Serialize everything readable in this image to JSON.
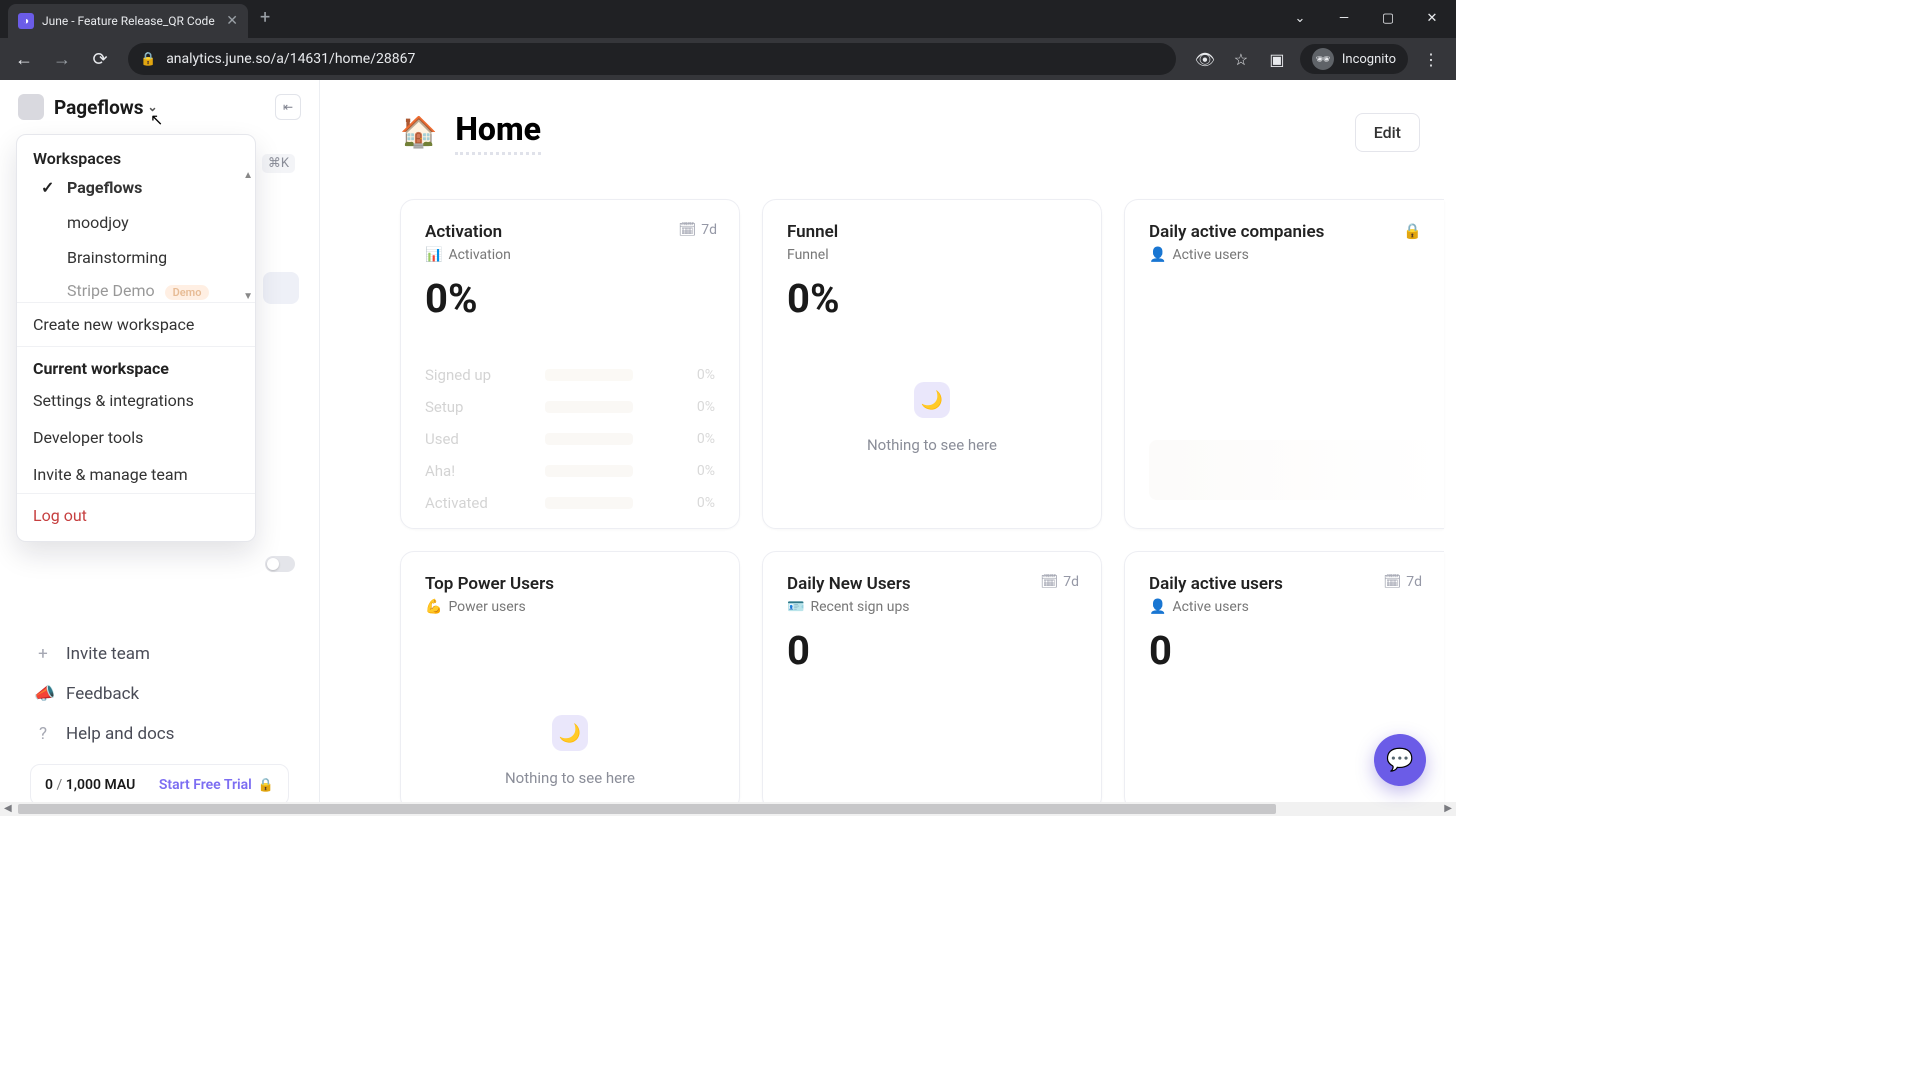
{
  "browser": {
    "tab_title": "June - Feature Release_QR Code",
    "url": "analytics.june.so/a/14631/home/28867",
    "incognito_label": "Incognito"
  },
  "sidebar": {
    "workspace_name": "Pageflows",
    "shortcut": "⌘K",
    "dropdown": {
      "section1_title": "Workspaces",
      "items": [
        {
          "name": "Pageflows",
          "selected": true
        },
        {
          "name": "moodjoy",
          "selected": false
        },
        {
          "name": "Brainstorming",
          "selected": false
        },
        {
          "name": "Stripe Demo",
          "selected": false,
          "badge": "Demo"
        }
      ],
      "create": "Create new workspace",
      "section2_title": "Current workspace",
      "links": {
        "settings": "Settings & integrations",
        "devtools": "Developer tools",
        "invite": "Invite & manage team"
      },
      "logout": "Log out"
    },
    "bottom": {
      "invite_team": "Invite team",
      "feedback": "Feedback",
      "help": "Help and docs"
    },
    "mau": {
      "current": "0",
      "limit": "1,000",
      "unit": "MAU",
      "trial": "Start Free Trial"
    }
  },
  "page": {
    "title": "Home",
    "edit": "Edit"
  },
  "cards": {
    "activation": {
      "title": "Activation",
      "subtitle": "Activation",
      "period": "7d",
      "value": "0%",
      "rows": [
        {
          "label": "Signed up",
          "pct": "0%"
        },
        {
          "label": "Setup",
          "pct": "0%"
        },
        {
          "label": "Used",
          "pct": "0%"
        },
        {
          "label": "Aha!",
          "pct": "0%"
        },
        {
          "label": "Activated",
          "pct": "0%"
        }
      ]
    },
    "funnel": {
      "title": "Funnel",
      "subtitle": "Funnel",
      "value": "0%",
      "empty": "Nothing to see here"
    },
    "daily_companies": {
      "title": "Daily active companies",
      "subtitle": "Active users"
    },
    "power_users": {
      "title": "Top Power Users",
      "subtitle": "Power users",
      "empty": "Nothing to see here"
    },
    "daily_new": {
      "title": "Daily New Users",
      "subtitle": "Recent sign ups",
      "period": "7d",
      "value": "0"
    },
    "daily_active": {
      "title": "Daily active users",
      "subtitle": "Active users",
      "period": "7d",
      "value": "0"
    }
  }
}
